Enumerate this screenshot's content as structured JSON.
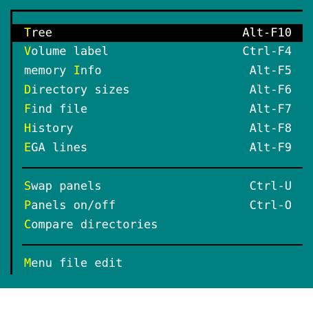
{
  "menu": {
    "items": [
      {
        "hot": "T",
        "rest": "ree",
        "shortcut": "Alt-F10",
        "selected": true
      },
      {
        "hot": "V",
        "rest": "olume label",
        "shortcut": "Ctrl-F4"
      },
      {
        "pre": "memory ",
        "hot": "I",
        "rest": "nfo",
        "shortcut": "Alt-F5"
      },
      {
        "hot": "D",
        "rest": "irectory sizes",
        "shortcut": "Alt-F6"
      },
      {
        "hot": "F",
        "rest": "ind file",
        "shortcut": "Alt-F7"
      },
      {
        "hot": "H",
        "rest": "istory",
        "shortcut": "Alt-F8"
      },
      {
        "hot": "E",
        "rest": "GA lines",
        "shortcut": "Alt-F9"
      },
      {
        "hot": "S",
        "rest": "wap panels",
        "shortcut": "Ctrl-U"
      },
      {
        "hot": "P",
        "rest": "anels on/off",
        "shortcut": "Ctrl-O"
      },
      {
        "hot": "C",
        "rest": "ompare directories",
        "shortcut": ""
      },
      {
        "hot": "M",
        "rest": "enu file edit",
        "shortcut": ""
      }
    ]
  },
  "colors": {
    "background": "#008080",
    "text": "#ffffff",
    "hotkey": "#ffff00",
    "selection": "#000000"
  }
}
